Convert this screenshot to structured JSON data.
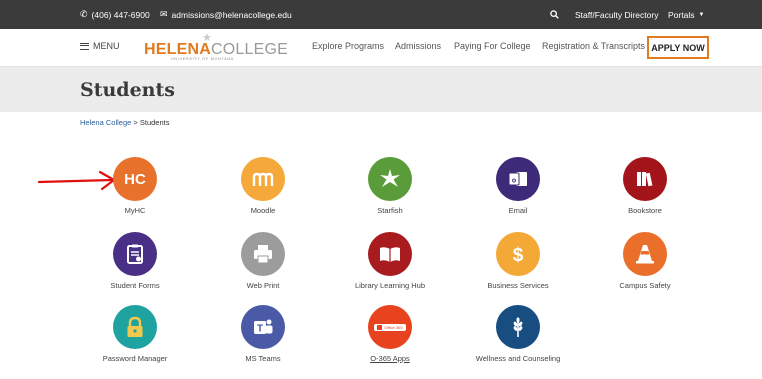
{
  "topbar": {
    "phone": "(406) 447-6900",
    "email": "admissions@helenacollege.edu",
    "search_icon": "search-icon",
    "staff_directory": "Staff/Faculty Directory",
    "portals": "Portals"
  },
  "nav": {
    "menu_label": "MENU",
    "logo_bold": "HELENA",
    "logo_light": "COLLEGE",
    "logo_sub": "UNIVERSITY OF MONTANA",
    "links": [
      "Explore Programs",
      "Admissions",
      "Paying For College",
      "Registration & Transcripts"
    ],
    "apply_label": "APPLY NOW"
  },
  "page": {
    "title": "Students",
    "breadcrumb_link": "Helena College",
    "breadcrumb_sep": ">",
    "breadcrumb_current": "Students"
  },
  "tiles": [
    {
      "label": "MyHC",
      "color": "#e8712b",
      "icon": "hc-logo-icon"
    },
    {
      "label": "Moodle",
      "color": "#f4a93a",
      "icon": "moodle-icon"
    },
    {
      "label": "Starfish",
      "color": "#5a9c3a",
      "icon": "starfish-icon"
    },
    {
      "label": "Email",
      "color": "#3d2a78",
      "icon": "outlook-icon"
    },
    {
      "label": "Bookstore",
      "color": "#a4151b",
      "icon": "books-icon"
    },
    {
      "label": "Student Forms",
      "color": "#4a2f86",
      "icon": "clipboard-icon"
    },
    {
      "label": "Web Print",
      "color": "#9c9c9c",
      "icon": "printer-icon"
    },
    {
      "label": "Library Learning Hub",
      "color": "#a81b1f",
      "icon": "open-book-icon"
    },
    {
      "label": "Business Services",
      "color": "#f4a836",
      "icon": "dollar-icon"
    },
    {
      "label": "Campus Safety",
      "color": "#ea6f2a",
      "icon": "traffic-cone-icon"
    },
    {
      "label": "Password Manager",
      "color": "#1fa3a1",
      "icon": "padlock-icon"
    },
    {
      "label": "MS Teams",
      "color": "#4b5aa7",
      "icon": "teams-icon"
    },
    {
      "label": "O-365 Apps",
      "color": "#e8431f",
      "icon": "office-icon"
    },
    {
      "label": "Wellness and Counseling",
      "color": "#174d80",
      "icon": "wheat-icon"
    }
  ],
  "tile_icon_text": {
    "myhc": "HC",
    "office_badge": "Office 365"
  },
  "annotation": {
    "arrow_color": "#e01010"
  }
}
